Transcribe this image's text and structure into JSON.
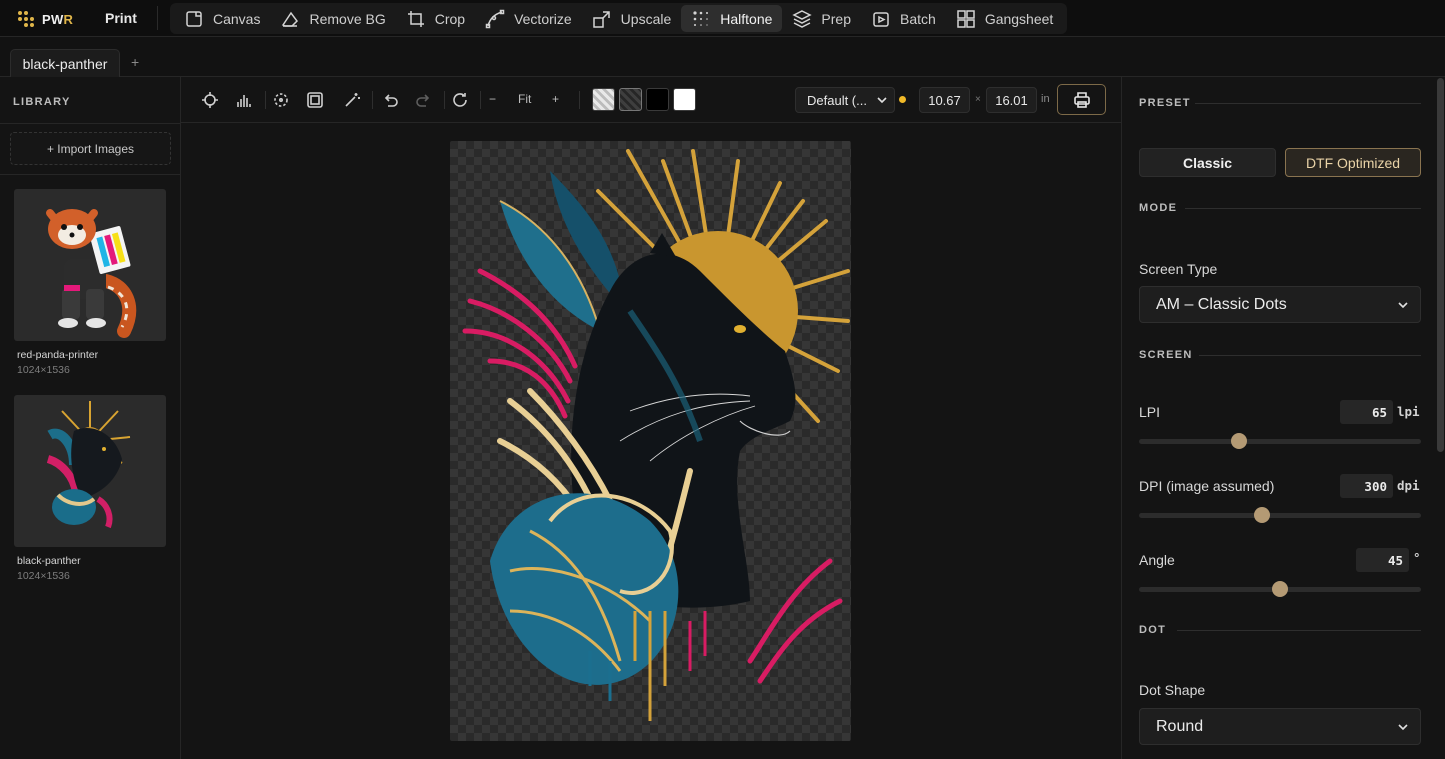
{
  "app": {
    "brand": "PWR",
    "print_link": "Print"
  },
  "nav": {
    "items": [
      {
        "label": "Canvas",
        "icon": "canvas-icon"
      },
      {
        "label": "Remove BG",
        "icon": "eraser-icon"
      },
      {
        "label": "Crop",
        "icon": "crop-icon"
      },
      {
        "label": "Vectorize",
        "icon": "bezier-icon"
      },
      {
        "label": "Upscale",
        "icon": "upscale-icon"
      },
      {
        "label": "Halftone",
        "icon": "halftone-dots-icon",
        "active": true
      },
      {
        "label": "Prep",
        "icon": "layers-icon"
      },
      {
        "label": "Batch",
        "icon": "batch-icon"
      },
      {
        "label": "Gangsheet",
        "icon": "grid-icon"
      }
    ]
  },
  "tabs": {
    "active": "black-panther",
    "add": "+"
  },
  "library": {
    "title": "LIBRARY",
    "import_label": "+ Import Images",
    "items": [
      {
        "name": "red-panda-printer",
        "size": "1024×1536"
      },
      {
        "name": "black-panther",
        "size": "1024×1536"
      }
    ]
  },
  "toolbar": {
    "zoom_out": "−",
    "zoom_label": "Fit",
    "zoom_in": "+",
    "swatches": [
      "transparent-light",
      "transparent-dark",
      "#000000",
      "#ffffff"
    ],
    "preset_value": "Default (...",
    "width": "10.67",
    "times": "×",
    "height": "16.01",
    "unit": "in",
    "status_color": "#f0b928"
  },
  "panel": {
    "preset_title": "PRESET",
    "preset_classic": "Classic",
    "preset_dtf": "DTF Optimized",
    "mode_title": "MODE",
    "screen_type_label": "Screen Type",
    "screen_type_value": "AM – Classic Dots",
    "screen_title": "SCREEN",
    "lpi_label": "LPI",
    "lpi_value": "65",
    "lpi_unit": "lpi",
    "lpi_fraction": 0.355,
    "dpi_label": "DPI (image assumed)",
    "dpi_value": "300",
    "dpi_unit": "dpi",
    "dpi_fraction": 0.435,
    "angle_label": "Angle",
    "angle_value": "45",
    "angle_unit": "°",
    "angle_fraction": 0.5,
    "dot_title": "DOT",
    "dot_shape_label": "Dot Shape",
    "dot_shape_value": "Round"
  },
  "colors": {
    "accent_gold": "#e0b64a",
    "knob": "#b49a74"
  }
}
